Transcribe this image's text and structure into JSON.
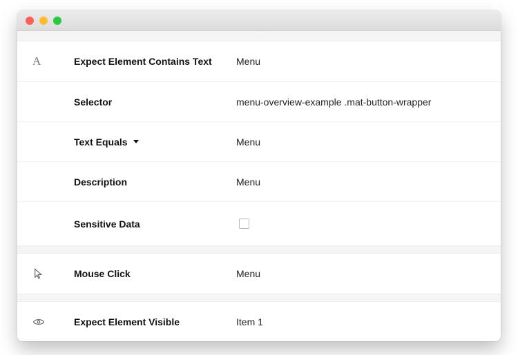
{
  "window": {
    "close": "close",
    "minimize": "minimize",
    "maximize": "maximize"
  },
  "steps": [
    {
      "icon": "text-icon",
      "title": "Expect Element Contains Text",
      "value": "Menu",
      "fields": [
        {
          "label": "Selector",
          "value": "menu-overview-example .mat-button-wrapper",
          "type": "text"
        },
        {
          "label": "Text Equals",
          "value": "Menu",
          "type": "dropdown"
        },
        {
          "label": "Description",
          "value": "Menu",
          "type": "text"
        },
        {
          "label": "Sensitive Data",
          "value": "",
          "type": "checkbox",
          "checked": false
        }
      ]
    },
    {
      "icon": "cursor-icon",
      "title": "Mouse Click",
      "value": "Menu"
    },
    {
      "icon": "eye-icon",
      "title": "Expect Element Visible",
      "value": "Item 1"
    }
  ]
}
